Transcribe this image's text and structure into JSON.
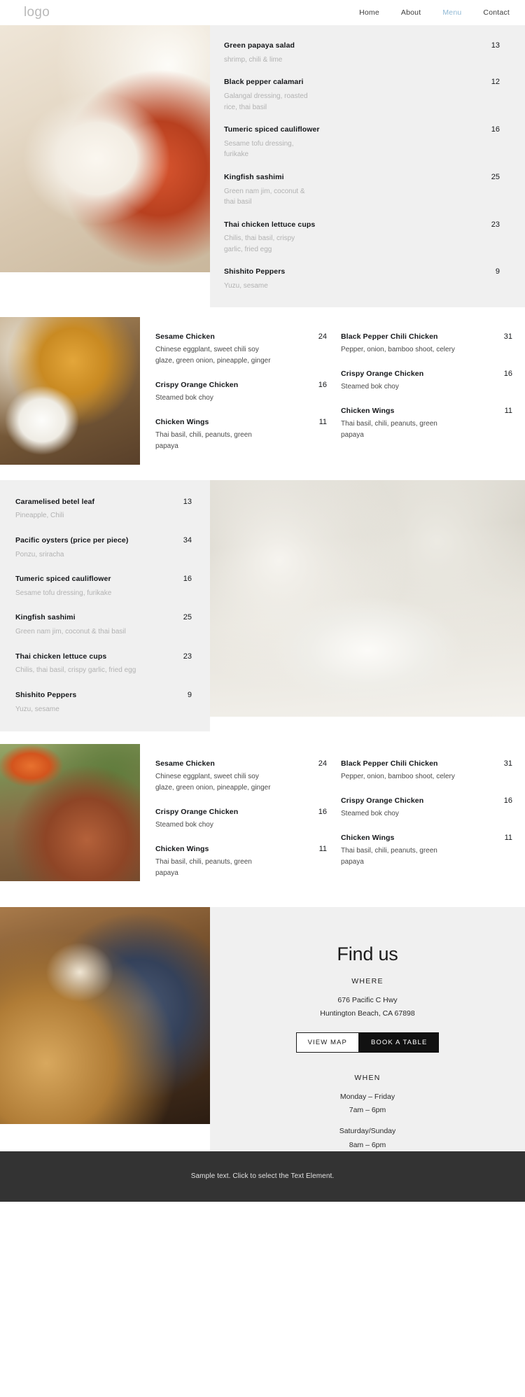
{
  "header": {
    "logo": "logo",
    "nav": [
      {
        "label": "Home",
        "active": false
      },
      {
        "label": "About",
        "active": false
      },
      {
        "label": "Menu",
        "active": true
      },
      {
        "label": "Contact",
        "active": false
      }
    ]
  },
  "section1": {
    "items": [
      {
        "name": "Green papaya salad",
        "desc": "shrimp, chili & lime",
        "price": "13"
      },
      {
        "name": "Black pepper calamari",
        "desc": "Galangal dressing, roasted rice, thai basil",
        "price": "12"
      },
      {
        "name": "Tumeric spiced cauliflower",
        "desc": "Sesame tofu dressing, furikake",
        "price": "16"
      },
      {
        "name": "Kingfish sashimi",
        "desc": "Green nam jim, coconut & thai basil",
        "price": "25"
      },
      {
        "name": "Thai chicken lettuce cups",
        "desc": "Chilis, thai basil, crispy garlic, fried egg",
        "price": "23"
      },
      {
        "name": "Shishito Peppers",
        "desc": "Yuzu, sesame",
        "price": "9"
      }
    ]
  },
  "section2": {
    "left": [
      {
        "name": "Sesame Chicken",
        "desc": "Chinese eggplant, sweet chili soy glaze, green onion, pineapple, ginger",
        "price": "24"
      },
      {
        "name": "Crispy Orange Chicken",
        "desc": "Steamed bok choy",
        "price": "16"
      },
      {
        "name": "Chicken Wings",
        "desc": "Thai basil, chili, peanuts, green papaya",
        "price": "11"
      }
    ],
    "right": [
      {
        "name": "Black Pepper Chili Chicken",
        "desc": "Pepper, onion, bamboo shoot, celery",
        "price": "31"
      },
      {
        "name": "Crispy Orange Chicken",
        "desc": "Steamed bok choy",
        "price": "16"
      },
      {
        "name": "Chicken Wings",
        "desc": "Thai basil, chili, peanuts, green papaya",
        "price": "11"
      }
    ]
  },
  "section3": {
    "items": [
      {
        "name": "Caramelised betel leaf",
        "desc": "Pineapple, Chili",
        "price": "13"
      },
      {
        "name": "Pacific oysters (price per piece)",
        "desc": "Ponzu, sriracha",
        "price": "34"
      },
      {
        "name": "Tumeric spiced cauliflower",
        "desc": "Sesame tofu dressing, furikake",
        "price": "16"
      },
      {
        "name": "Kingfish sashimi",
        "desc": "Green nam jim, coconut & thai basil",
        "price": "25"
      },
      {
        "name": "Thai chicken lettuce cups",
        "desc": "Chilis, thai basil, crispy garlic, fried egg",
        "price": "23"
      },
      {
        "name": "Shishito Peppers",
        "desc": "Yuzu, sesame",
        "price": "9"
      }
    ]
  },
  "section4": {
    "left": [
      {
        "name": "Sesame Chicken",
        "desc": "Chinese eggplant, sweet chili soy glaze, green onion, pineapple, ginger",
        "price": "24"
      },
      {
        "name": "Crispy Orange Chicken",
        "desc": "Steamed bok choy",
        "price": "16"
      },
      {
        "name": "Chicken Wings",
        "desc": "Thai basil, chili, peanuts, green papaya",
        "price": "11"
      }
    ],
    "right": [
      {
        "name": "Black Pepper Chili Chicken",
        "desc": "Pepper, onion, bamboo shoot, celery",
        "price": "31"
      },
      {
        "name": "Crispy Orange Chicken",
        "desc": "Steamed bok choy",
        "price": "16"
      },
      {
        "name": "Chicken Wings",
        "desc": "Thai basil, chili, peanuts, green papaya",
        "price": "11"
      }
    ]
  },
  "find_us": {
    "title": "Find us",
    "where_label": "WHERE",
    "address_line1": "676 Pacific C Hwy",
    "address_line2": "Huntington Beach, CA 67898",
    "view_map_label": "VIEW MAP",
    "book_table_label": "BOOK A TABLE",
    "when_label": "WHEN",
    "weekday_days": "Monday – Friday",
    "weekday_hours": "7am – 6pm",
    "weekend_days": "Saturday/Sunday",
    "weekend_hours": "8am – 6pm"
  },
  "footer": {
    "text": "Sample text. Click to select the Text Element."
  },
  "colors": {
    "accent": "#8fb8d4",
    "panel_grey": "#f0f0f0",
    "footer_bg": "#333333",
    "text_dark": "#15171a",
    "text_muted": "#b2b2b2"
  }
}
